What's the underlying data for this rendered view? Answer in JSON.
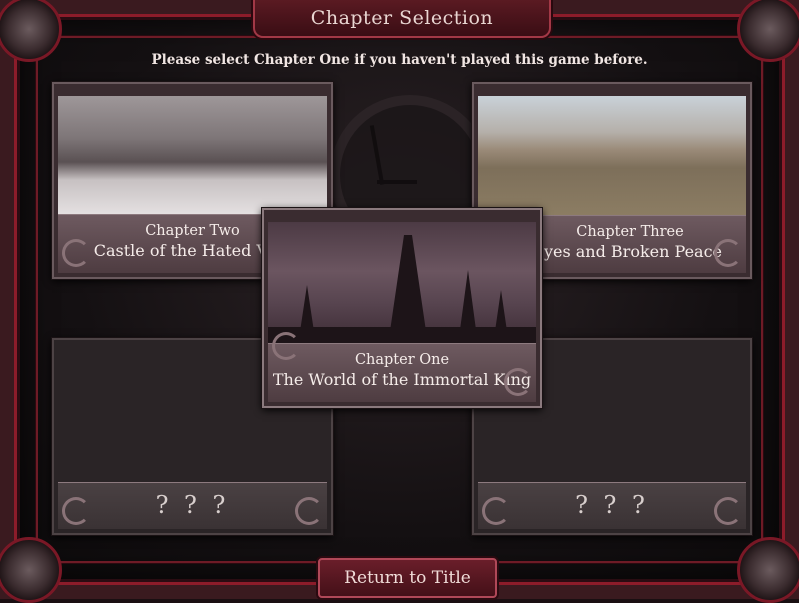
{
  "header": {
    "title": "Chapter Selection"
  },
  "instruction": "Please select Chapter One if you haven't played this game before.",
  "chapters": [
    {
      "subtitle": "Chapter Two",
      "title": "Castle of the Hated Vam"
    },
    {
      "subtitle": "Chapter Three",
      "title": "Eyes and Broken Peace"
    },
    {
      "subtitle": "Chapter One",
      "title": "The World of the Immortal King"
    }
  ],
  "locked": [
    {
      "label": "? ? ?"
    },
    {
      "label": "? ? ?"
    }
  ],
  "footer": {
    "return_label": "Return to Title"
  },
  "colors": {
    "accent": "#8c1c2a",
    "frame": "#3a1a1f",
    "text": "#f1e6e3"
  }
}
